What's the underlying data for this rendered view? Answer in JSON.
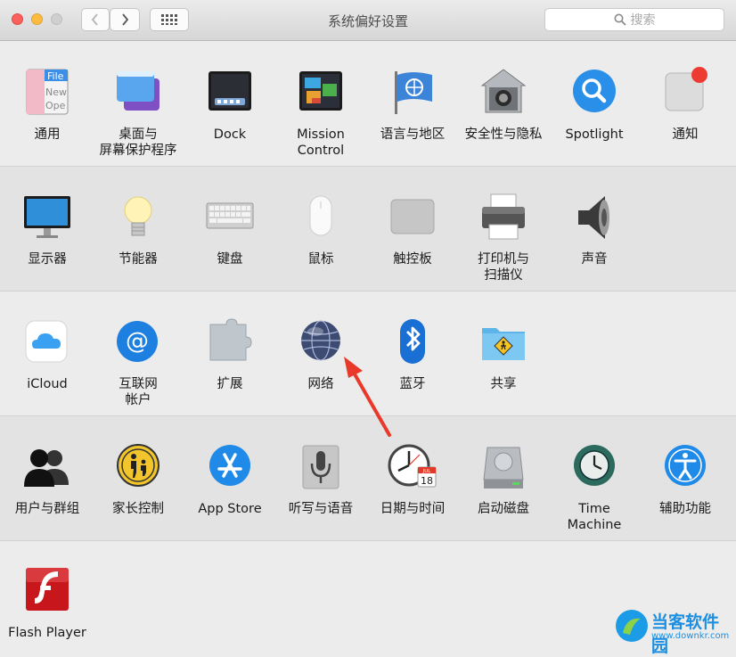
{
  "window": {
    "title": "系统偏好设置"
  },
  "toolbar": {
    "back": "‹",
    "forward": "›",
    "search_placeholder": "搜索"
  },
  "rows": [
    {
      "items": [
        {
          "label": "通用",
          "icon": "general-icon"
        },
        {
          "label": "桌面与\n屏幕保护程序",
          "icon": "desktop-screensaver-icon"
        },
        {
          "label": "Dock",
          "icon": "dock-icon"
        },
        {
          "label": "Mission\nControl",
          "icon": "mission-control-icon"
        },
        {
          "label": "语言与地区",
          "icon": "language-region-icon"
        },
        {
          "label": "安全性与隐私",
          "icon": "security-privacy-icon"
        },
        {
          "label": "Spotlight",
          "icon": "spotlight-icon"
        },
        {
          "label": "通知",
          "icon": "notifications-icon"
        }
      ]
    },
    {
      "items": [
        {
          "label": "显示器",
          "icon": "displays-icon"
        },
        {
          "label": "节能器",
          "icon": "energy-saver-icon"
        },
        {
          "label": "键盘",
          "icon": "keyboard-icon"
        },
        {
          "label": "鼠标",
          "icon": "mouse-icon"
        },
        {
          "label": "触控板",
          "icon": "trackpad-icon"
        },
        {
          "label": "打印机与\n扫描仪",
          "icon": "printers-scanners-icon"
        },
        {
          "label": "声音",
          "icon": "sound-icon"
        }
      ]
    },
    {
      "items": [
        {
          "label": "iCloud",
          "icon": "icloud-icon"
        },
        {
          "label": "互联网\n帐户",
          "icon": "internet-accounts-icon"
        },
        {
          "label": "扩展",
          "icon": "extensions-icon"
        },
        {
          "label": "网络",
          "icon": "network-icon"
        },
        {
          "label": "蓝牙",
          "icon": "bluetooth-icon"
        },
        {
          "label": "共享",
          "icon": "sharing-icon"
        }
      ]
    },
    {
      "items": [
        {
          "label": "用户与群组",
          "icon": "users-groups-icon"
        },
        {
          "label": "家长控制",
          "icon": "parental-controls-icon"
        },
        {
          "label": "App Store",
          "icon": "app-store-icon"
        },
        {
          "label": "听写与语音",
          "icon": "dictation-speech-icon"
        },
        {
          "label": "日期与时间",
          "icon": "date-time-icon"
        },
        {
          "label": "启动磁盘",
          "icon": "startup-disk-icon"
        },
        {
          "label": "Time Machine",
          "icon": "time-machine-icon"
        },
        {
          "label": "辅助功能",
          "icon": "accessibility-icon"
        }
      ]
    },
    {
      "items": [
        {
          "label": "Flash Player",
          "icon": "flash-player-icon"
        }
      ]
    }
  ],
  "icon_texts": {
    "general_file": "File",
    "general_new": "New",
    "general_open": "Ope",
    "calendar_month": "JUL",
    "calendar_day": "18"
  },
  "watermark": {
    "brand": "当客软件园",
    "url": "www.downkr.com"
  },
  "colors": {
    "close": "#fc605c",
    "minimize": "#fdbc40",
    "zoom": "#c9c9c9",
    "annotation_arrow": "#e8392a"
  }
}
